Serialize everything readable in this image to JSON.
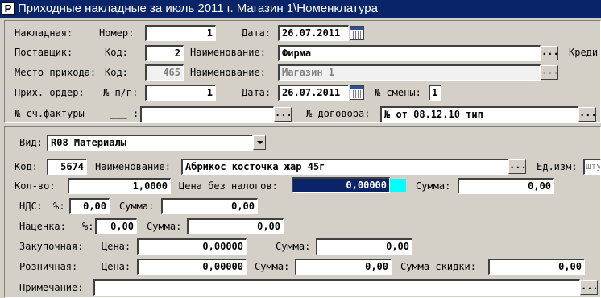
{
  "window": {
    "title": "Приходные накладные за июль 2011 г. Магазин 1\\Номенклатура",
    "icon_glyph": "P"
  },
  "header": {
    "nakladnaya_label": "Накладная:",
    "nomer_label": "Номер:",
    "nomer_value": "1",
    "data_label": "Дата:",
    "data_value": "26.07.2011",
    "postavshik_label": "Поставщик:",
    "kod_label": "Код:",
    "supplier_code": "2",
    "naim_label": "Наименование:",
    "supplier_name": "Фирма",
    "kredit_label": "Креди",
    "mesto_label": "Место прихода:",
    "mesto_kod_label": "Код:",
    "mesto_code": "465",
    "mesto_naim_label": "Наименование:",
    "mesto_name": "Магазин 1",
    "order_label": "Прих. ордер:",
    "order_num_label": "№ п/п:",
    "order_num": "1",
    "order_date_label": "Дата:",
    "order_date": "26.07.2011",
    "smena_label": "№ смены:",
    "smena_value": "1",
    "schf_label": "№ сч.фактуры",
    "schf_blank": "___",
    "schf_colon": ":",
    "schf_value": "",
    "dogovor_label": "№ договора:",
    "dogovor_value": "№  от 08.12.10 тип"
  },
  "item": {
    "vid_label": "Вид:",
    "vid_value": "R08 Материалы",
    "kod_label": "Код:",
    "kod_value": "5674",
    "naim_label": "Наименование:",
    "naim_value": "Абрикос косточка жар 45г",
    "edizm_label": "Ед.изм:",
    "edizm_value": "шту",
    "kolvo_label": "Кол-во:",
    "kolvo_value": "1,0000",
    "cena_bez_label": "Цена без налогов:",
    "cena_bez_value": "0,00000",
    "summa_label": "Сумма:",
    "summa_value": "0,00",
    "nds_label": "НДС:",
    "nds_pct_label": "%:",
    "nds_pct_value": "0,00",
    "nds_summa_label": "Сумма:",
    "nds_summa_value": "0,00",
    "nacenka_label": "Наценка:",
    "nacenka_pct_label": "%:",
    "nacenka_pct_value": "0,00",
    "nacenka_summa_label": "Сумма:",
    "nacenka_summa_value": "0,00",
    "zakup_label": "Закупочная:",
    "zakup_cena_label": "Цена:",
    "zakup_cena_value": "0,00000",
    "zakup_summa_label": "Сумма:",
    "zakup_summa_value": "0,00",
    "rozn_label": "Розничная:",
    "rozn_cena_label": "Цена:",
    "rozn_cena_value": "0,00000",
    "rozn_summa_label": "Сумма:",
    "rozn_summa_value": "0,00",
    "skidka_label": "Сумма скидки:",
    "skidka_value": "0,00",
    "prim_label": "Примечание:",
    "prim_value": ""
  },
  "buttons": {
    "ellipsis": "..."
  }
}
